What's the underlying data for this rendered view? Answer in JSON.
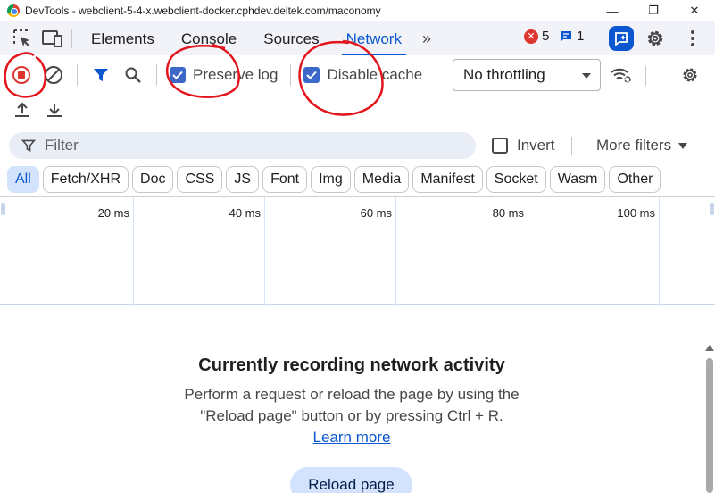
{
  "window": {
    "title": "DevTools - webclient-5-4-x.webclient-docker.cphdev.deltek.com/maconomy",
    "minimize_glyph": "—",
    "restore_glyph": "❐",
    "close_glyph": "✕"
  },
  "tabs": [
    {
      "label": "Elements"
    },
    {
      "label": "Console"
    },
    {
      "label": "Sources"
    },
    {
      "label": "Network"
    }
  ],
  "tabbar": {
    "more_tabs": "»",
    "error_count": "5",
    "error_glyph": "✕",
    "message_count": "1"
  },
  "toolbar": {
    "preserve_log_label": "Preserve log",
    "disable_cache_label": "Disable cache",
    "throttling_value": "No throttling"
  },
  "filter": {
    "placeholder": "Filter",
    "invert_label": "Invert",
    "more_filters_label": "More filters"
  },
  "type_filters": [
    "All",
    "Fetch/XHR",
    "Doc",
    "CSS",
    "JS",
    "Font",
    "Img",
    "Media",
    "Manifest",
    "Socket",
    "Wasm",
    "Other"
  ],
  "overview": {
    "ticks": [
      "20 ms",
      "40 ms",
      "60 ms",
      "80 ms",
      "100 ms"
    ]
  },
  "empty_state": {
    "heading": "Currently recording network activity",
    "body": "Perform a request or reload the page by using the \"Reload page\" button or by pressing Ctrl + R.",
    "learn_more": "Learn more",
    "reload_button": "Reload page"
  },
  "colors": {
    "accent": "#0b57d0",
    "record_red": "#dc362e",
    "annotation_red": "#e3141b",
    "checkbox_blue": "#3b68c9"
  }
}
